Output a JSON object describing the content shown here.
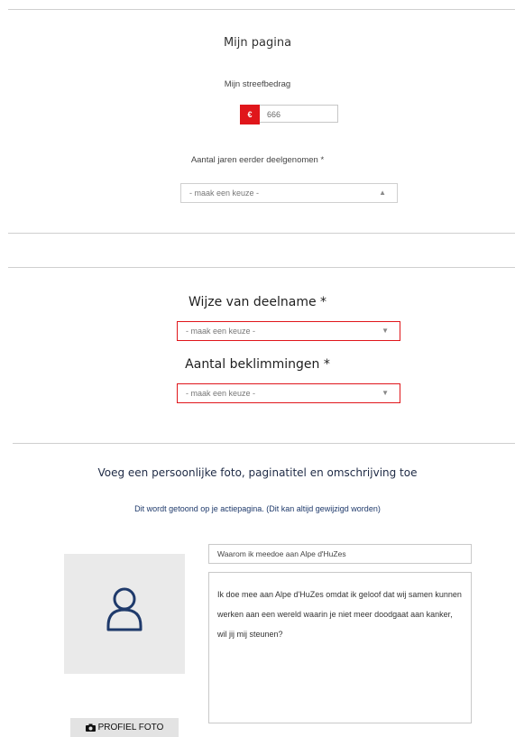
{
  "section1": {
    "title": "Mijn pagina",
    "target_label": "Mijn streefbedrag",
    "currency_symbol": "€",
    "target_value": "666",
    "years_label": "Aantal jaren eerder deelgenomen *",
    "years_select": "- maak een keuze -"
  },
  "section2": {
    "participation_label": "Wijze van deelname *",
    "participation_select": "- maak een keuze -",
    "climbs_label": "Aantal beklimmingen *",
    "climbs_select": "- maak een keuze -"
  },
  "section3": {
    "heading": "Voeg een persoonlijke foto, paginatitel en omschrijving toe",
    "subheading": "Dit wordt getoond op je actiepagina. (Dit kan altijd gewijzigd worden)",
    "page_title_value": "Waarom ik meedoe aan Alpe d'HuZes",
    "description_value": "Ik doe mee aan Alpe d'HuZes omdat ik geloof dat wij samen kunnen werken aan een wereld waarin je niet meer doodgaat aan kanker, wil jij mij steunen?",
    "photo_button_label": "PROFIEL FOTO"
  },
  "colors": {
    "accent": "#e0161b",
    "photo_bg": "#eaeaea",
    "icon": "#1f3a6b"
  },
  "icons": {
    "photo_placeholder": "user-outline-icon",
    "photo_button": "camera-icon",
    "select_caret": "caret-icon"
  }
}
